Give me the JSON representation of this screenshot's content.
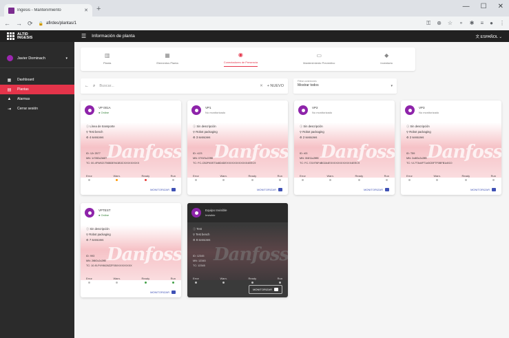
{
  "browser": {
    "tab_title": "Ingesis - Mantenimiento",
    "tab_close": "✕",
    "new_tab": "+",
    "url": "afirdes/plantas/1",
    "window_controls": [
      "—",
      "☐",
      "✕"
    ]
  },
  "app": {
    "logo_line1": "ALTID",
    "logo_line2": "INGESIS",
    "menu_icon": "☰",
    "page_title": "Información de planta",
    "language": "文 ESPAÑOL ⌄"
  },
  "sidebar": {
    "user_name": "Javier Dominach",
    "user_caret": "▾",
    "items": [
      {
        "label": "Dashboard",
        "icon": "▦",
        "icon_name": "dashboard-icon",
        "active": false
      },
      {
        "label": "Plantas",
        "icon": "▤",
        "icon_name": "plant-icon",
        "active": true
      },
      {
        "label": "Alarmas",
        "icon": "▲",
        "icon_name": "alarm-icon",
        "active": false
      },
      {
        "label": "Cerrar sesión",
        "icon": "⇥",
        "icon_name": "logout-icon",
        "active": false
      }
    ]
  },
  "tabs": [
    {
      "label": "Planta",
      "icon": "▥",
      "active": false
    },
    {
      "label": "Elementos Planta",
      "icon": "▦",
      "active": false
    },
    {
      "label": "Conectadores de Presencia",
      "icon": "◉",
      "active": true
    },
    {
      "label": "Mantenimiento Preventivo",
      "icon": "▭",
      "active": false
    },
    {
      "label": "Inventario",
      "icon": "◆",
      "active": false
    }
  ],
  "filter": {
    "search_icon": "🔍",
    "search_placeholder": "Buscar...",
    "back_icon": "←",
    "clear_icon": "✕",
    "new_label": "+ NUEVO",
    "select_label": "Filtrar conexiones",
    "select_value": "Mostrar todos",
    "select_arrow": "▾"
  },
  "cards": [
    {
      "name": "VP 001A",
      "status": "● Online",
      "online": true,
      "dark": false,
      "lines": [
        "ⓘ Línea de transporte",
        "⚲ Test bench",
        "⚙ 4 sensores"
      ],
      "id": "ID: 12r 2577",
      "mac": "MN: 1r78f2c2b6f7",
      "tc": "TC: 00-4FW021T56B3E941B3CXXXXXXXXX",
      "states": [
        {
          "label": "Error",
          "color": "#bdbdbd"
        },
        {
          "label": "Warn.",
          "color": "#ff9800"
        },
        {
          "label": "Ready",
          "color": "#e53935"
        },
        {
          "label": "Run",
          "color": "#bdbdbd"
        }
      ],
      "monitor": "MONITORIZAR"
    },
    {
      "name": "VP1",
      "status": "No monitorizado",
      "online": false,
      "dark": false,
      "lines": [
        "ⓘ Sin descripción",
        "⚲ Robot packaging",
        "⚙ 3 sensores"
      ],
      "id": "ID: r123",
      "mac": "MN: 07f1f3c22ff8",
      "tc": "TC: FC-CB2P45ST3d8D4DEXXXXXXXXXXXX4EEC9",
      "states": [
        {
          "label": "Error",
          "color": "#bdbdbd"
        },
        {
          "label": "Warn.",
          "color": "#bdbdbd"
        },
        {
          "label": "Ready",
          "color": "#bdbdbd"
        },
        {
          "label": "Run",
          "color": "#bdbdbd"
        }
      ],
      "monitor": "MONITORIZAR"
    },
    {
      "name": "VP2",
      "status": "No monitorizado",
      "online": false,
      "dark": false,
      "lines": [
        "ⓘ Sin descripción",
        "⚲ Robot packaging",
        "⚙ 2 sensores"
      ],
      "id": "ID: r03",
      "mac": "MN: 0f4f11c2fff8",
      "tc": "TC: FC-7219T6FdB02A4EXXXXXXXXXXXX4EEC9",
      "states": [
        {
          "label": "Error",
          "color": "#bdbdbd"
        },
        {
          "label": "Warn.",
          "color": "#bdbdbd"
        },
        {
          "label": "Ready",
          "color": "#bdbdbd"
        },
        {
          "label": "Run",
          "color": "#bdbdbd"
        }
      ],
      "monitor": "MONITORIZAR"
    },
    {
      "name": "VP3",
      "status": "No monitorizado",
      "online": false,
      "dark": false,
      "lines": [
        "ⓘ Sin descripción",
        "⚲ Robot packaging",
        "⚙ 2 sensores"
      ],
      "id": "ID: T59",
      "mac": "MN: 2c8f2c2c2ff8",
      "tc": "TC: VL7T3d4FT1d0CBFTF0BFB1d0C0",
      "states": [
        {
          "label": "Error",
          "color": "#bdbdbd"
        },
        {
          "label": "Warn.",
          "color": "#bdbdbd"
        },
        {
          "label": "Ready",
          "color": "#bdbdbd"
        },
        {
          "label": "Run",
          "color": "#bdbdbd"
        }
      ],
      "monitor": "MONITORIZAR"
    },
    {
      "name": "VPTEST",
      "status": "● Online",
      "online": true,
      "dark": false,
      "lines": [
        "ⓘ Sin descripción",
        "⚲ Robot packaging",
        "⚙ 7 sensores"
      ],
      "id": "ID: 993",
      "mac": "MN: 2f8f2c2c2ff8",
      "tc": "TC: 10-f0-P4Y8626ZZF05XXXXXXXXX",
      "states": [
        {
          "label": "Error",
          "color": "#bdbdbd"
        },
        {
          "label": "Warn.",
          "color": "#bdbdbd"
        },
        {
          "label": "Ready",
          "color": "#43a047"
        },
        {
          "label": "Run",
          "color": "#43a047"
        }
      ],
      "monitor": "MONITORIZAR"
    },
    {
      "name": "Equipo Invisible",
      "status": "Invisible",
      "online": false,
      "dark": true,
      "lines": [
        "ⓘ Test",
        "⚲ Test bench",
        "⚙ 8 sensores"
      ],
      "id": "ID: 12345",
      "mac": "MN: 12345",
      "tc": "TC: 12345",
      "states": [
        {
          "label": "Error",
          "color": "#bdbdbd"
        },
        {
          "label": "Warn.",
          "color": "#bdbdbd"
        },
        {
          "label": "Ready",
          "color": "#bdbdbd"
        },
        {
          "label": "Run",
          "color": "#bdbdbd"
        }
      ],
      "monitor": "MONITORIZAR"
    }
  ],
  "watermark": "Danfoss"
}
